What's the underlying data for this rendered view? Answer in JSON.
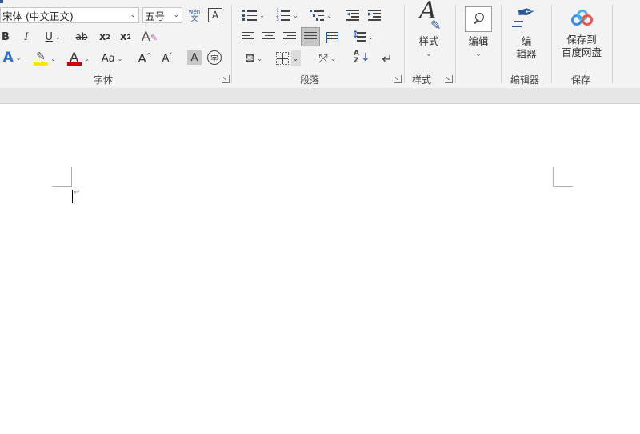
{
  "font_group": {
    "font_name": "宋体 (中文正文)",
    "font_size": "五号",
    "phonetic_top": "wén",
    "phonetic_bottom": "文",
    "char_border": "A",
    "bold": "B",
    "italic": "I",
    "underline": "U",
    "strikethrough": "ab",
    "subscript": "x",
    "subscript_small": "2",
    "superscript": "x",
    "superscript_small": "2",
    "text_effect": "A",
    "highlight_glyph": "✎",
    "font_color": "A",
    "change_case": "Aa",
    "grow_font": "A",
    "shrink_font": "A",
    "char_shading": "A",
    "enclose_char": "字",
    "label": "字体"
  },
  "paragraph_group": {
    "label": "段落"
  },
  "styles_group": {
    "button_label": "样式",
    "label": "样式"
  },
  "editing_group": {
    "button_label": "编辑"
  },
  "editor_group": {
    "button_line1": "编",
    "button_line2": "辑器",
    "label": "编辑器"
  },
  "save_group": {
    "button_line1": "保存到",
    "button_line2": "百度网盘",
    "label": "保存"
  },
  "document": {
    "paragraph_mark": "↵"
  },
  "colors": {
    "highlight": "#ffe600",
    "font_color": "#d00000",
    "accent": "#2b579a",
    "text_effect": "#2f6fce",
    "baidu_blue": "#3a8ee6"
  }
}
